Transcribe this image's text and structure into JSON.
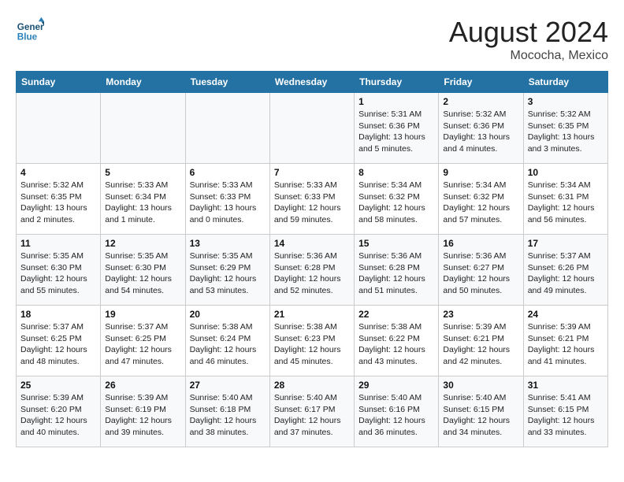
{
  "header": {
    "logo_line1": "General",
    "logo_line2": "Blue",
    "month_year": "August 2024",
    "location": "Mococha, Mexico"
  },
  "days_of_week": [
    "Sunday",
    "Monday",
    "Tuesday",
    "Wednesday",
    "Thursday",
    "Friday",
    "Saturday"
  ],
  "weeks": [
    [
      {
        "num": "",
        "detail": ""
      },
      {
        "num": "",
        "detail": ""
      },
      {
        "num": "",
        "detail": ""
      },
      {
        "num": "",
        "detail": ""
      },
      {
        "num": "1",
        "detail": "Sunrise: 5:31 AM\nSunset: 6:36 PM\nDaylight: 13 hours\nand 5 minutes."
      },
      {
        "num": "2",
        "detail": "Sunrise: 5:32 AM\nSunset: 6:36 PM\nDaylight: 13 hours\nand 4 minutes."
      },
      {
        "num": "3",
        "detail": "Sunrise: 5:32 AM\nSunset: 6:35 PM\nDaylight: 13 hours\nand 3 minutes."
      }
    ],
    [
      {
        "num": "4",
        "detail": "Sunrise: 5:32 AM\nSunset: 6:35 PM\nDaylight: 13 hours\nand 2 minutes."
      },
      {
        "num": "5",
        "detail": "Sunrise: 5:33 AM\nSunset: 6:34 PM\nDaylight: 13 hours\nand 1 minute."
      },
      {
        "num": "6",
        "detail": "Sunrise: 5:33 AM\nSunset: 6:33 PM\nDaylight: 13 hours\nand 0 minutes."
      },
      {
        "num": "7",
        "detail": "Sunrise: 5:33 AM\nSunset: 6:33 PM\nDaylight: 12 hours\nand 59 minutes."
      },
      {
        "num": "8",
        "detail": "Sunrise: 5:34 AM\nSunset: 6:32 PM\nDaylight: 12 hours\nand 58 minutes."
      },
      {
        "num": "9",
        "detail": "Sunrise: 5:34 AM\nSunset: 6:32 PM\nDaylight: 12 hours\nand 57 minutes."
      },
      {
        "num": "10",
        "detail": "Sunrise: 5:34 AM\nSunset: 6:31 PM\nDaylight: 12 hours\nand 56 minutes."
      }
    ],
    [
      {
        "num": "11",
        "detail": "Sunrise: 5:35 AM\nSunset: 6:30 PM\nDaylight: 12 hours\nand 55 minutes."
      },
      {
        "num": "12",
        "detail": "Sunrise: 5:35 AM\nSunset: 6:30 PM\nDaylight: 12 hours\nand 54 minutes."
      },
      {
        "num": "13",
        "detail": "Sunrise: 5:35 AM\nSunset: 6:29 PM\nDaylight: 12 hours\nand 53 minutes."
      },
      {
        "num": "14",
        "detail": "Sunrise: 5:36 AM\nSunset: 6:28 PM\nDaylight: 12 hours\nand 52 minutes."
      },
      {
        "num": "15",
        "detail": "Sunrise: 5:36 AM\nSunset: 6:28 PM\nDaylight: 12 hours\nand 51 minutes."
      },
      {
        "num": "16",
        "detail": "Sunrise: 5:36 AM\nSunset: 6:27 PM\nDaylight: 12 hours\nand 50 minutes."
      },
      {
        "num": "17",
        "detail": "Sunrise: 5:37 AM\nSunset: 6:26 PM\nDaylight: 12 hours\nand 49 minutes."
      }
    ],
    [
      {
        "num": "18",
        "detail": "Sunrise: 5:37 AM\nSunset: 6:25 PM\nDaylight: 12 hours\nand 48 minutes."
      },
      {
        "num": "19",
        "detail": "Sunrise: 5:37 AM\nSunset: 6:25 PM\nDaylight: 12 hours\nand 47 minutes."
      },
      {
        "num": "20",
        "detail": "Sunrise: 5:38 AM\nSunset: 6:24 PM\nDaylight: 12 hours\nand 46 minutes."
      },
      {
        "num": "21",
        "detail": "Sunrise: 5:38 AM\nSunset: 6:23 PM\nDaylight: 12 hours\nand 45 minutes."
      },
      {
        "num": "22",
        "detail": "Sunrise: 5:38 AM\nSunset: 6:22 PM\nDaylight: 12 hours\nand 43 minutes."
      },
      {
        "num": "23",
        "detail": "Sunrise: 5:39 AM\nSunset: 6:21 PM\nDaylight: 12 hours\nand 42 minutes."
      },
      {
        "num": "24",
        "detail": "Sunrise: 5:39 AM\nSunset: 6:21 PM\nDaylight: 12 hours\nand 41 minutes."
      }
    ],
    [
      {
        "num": "25",
        "detail": "Sunrise: 5:39 AM\nSunset: 6:20 PM\nDaylight: 12 hours\nand 40 minutes."
      },
      {
        "num": "26",
        "detail": "Sunrise: 5:39 AM\nSunset: 6:19 PM\nDaylight: 12 hours\nand 39 minutes."
      },
      {
        "num": "27",
        "detail": "Sunrise: 5:40 AM\nSunset: 6:18 PM\nDaylight: 12 hours\nand 38 minutes."
      },
      {
        "num": "28",
        "detail": "Sunrise: 5:40 AM\nSunset: 6:17 PM\nDaylight: 12 hours\nand 37 minutes."
      },
      {
        "num": "29",
        "detail": "Sunrise: 5:40 AM\nSunset: 6:16 PM\nDaylight: 12 hours\nand 36 minutes."
      },
      {
        "num": "30",
        "detail": "Sunrise: 5:40 AM\nSunset: 6:15 PM\nDaylight: 12 hours\nand 34 minutes."
      },
      {
        "num": "31",
        "detail": "Sunrise: 5:41 AM\nSunset: 6:15 PM\nDaylight: 12 hours\nand 33 minutes."
      }
    ]
  ]
}
